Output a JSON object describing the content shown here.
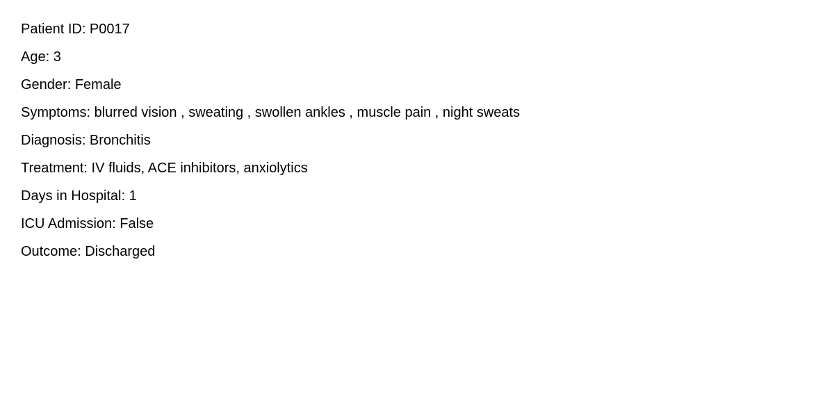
{
  "record": {
    "patient_id": "Patient ID: P0017",
    "age": "Age: 3",
    "gender": "Gender: Female",
    "symptoms": "Symptoms: blurred vision , sweating , swollen ankles , muscle pain , night sweats",
    "diagnosis": "Diagnosis: Bronchitis",
    "treatment": "Treatment: IV fluids, ACE inhibitors, anxiolytics",
    "days_in_hospital": "Days in Hospital: 1",
    "icu_admission": "ICU Admission: False",
    "outcome": "Outcome: Discharged"
  }
}
